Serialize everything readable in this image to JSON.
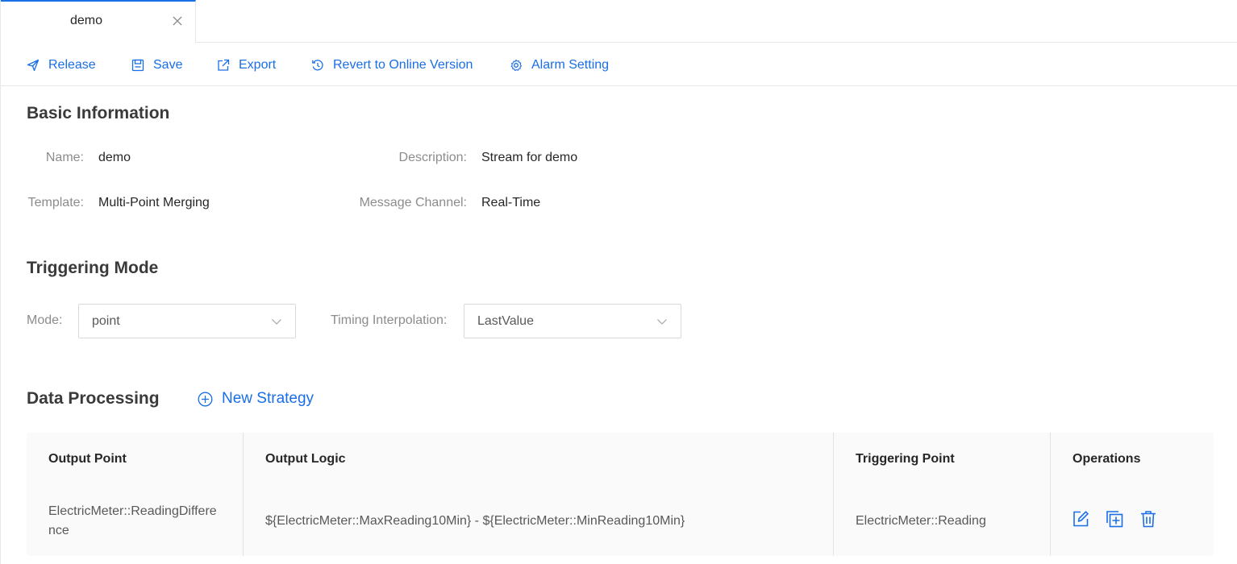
{
  "tab": {
    "label": "demo"
  },
  "toolbar": {
    "release": "Release",
    "save": "Save",
    "export": "Export",
    "revert": "Revert to Online Version",
    "alarm": "Alarm Setting"
  },
  "basic": {
    "title": "Basic Information",
    "name_label": "Name:",
    "name_value": "demo",
    "description_label": "Description:",
    "description_value": "Stream for demo",
    "template_label": "Template:",
    "template_value": "Multi-Point Merging",
    "channel_label": "Message Channel:",
    "channel_value": "Real-Time"
  },
  "triggering": {
    "title": "Triggering Mode",
    "mode_label": "Mode:",
    "mode_value": "point",
    "interp_label": "Timing Interpolation:",
    "interp_value": "LastValue"
  },
  "processing": {
    "title": "Data Processing",
    "new_strategy": "New Strategy",
    "columns": [
      "Output Point",
      "Output Logic",
      "Triggering Point",
      "Operations"
    ],
    "rows": [
      {
        "output_point_line1": "ElectricMeter::ReadingDiffere",
        "output_point_line2": "nce",
        "output_logic": "${ElectricMeter::MaxReading10Min} - ${ElectricMeter::MinReading10Min}",
        "triggering_point": "ElectricMeter::Reading"
      }
    ]
  },
  "colors": {
    "accent": "#1a6ee6",
    "label": "#8c8c8c",
    "border": "#e8e8e8"
  }
}
